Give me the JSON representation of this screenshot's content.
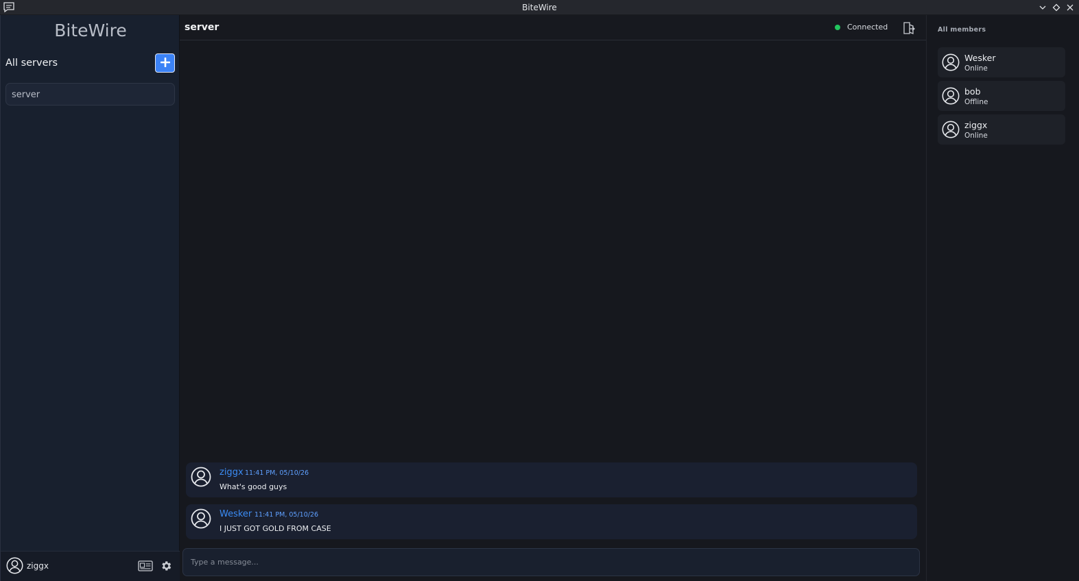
{
  "window": {
    "title": "BiteWire",
    "icons": [
      "chat-bubble-icon",
      "minimize-icon",
      "maximize-icon",
      "close-icon"
    ]
  },
  "sidebar": {
    "brand": "BiteWire",
    "servers_header": "All servers",
    "add_icon": "plus-icon",
    "servers": [
      {
        "name": "server"
      }
    ],
    "user": {
      "name": "ziggx"
    }
  },
  "chat": {
    "channel": "server",
    "status": "Connected",
    "status_color": "#22c55e",
    "messages": [
      {
        "author": "ziggx",
        "time": "11:41 PM, 05/10/26",
        "text": "What's good guys"
      },
      {
        "author": "Wesker",
        "time": "11:41 PM, 05/10/26",
        "text": "I JUST GOT GOLD FROM CASE"
      }
    ],
    "composer": {
      "placeholder": "Type a message...",
      "value": ""
    }
  },
  "members": {
    "header": "All members",
    "list": [
      {
        "name": "Wesker",
        "status": "Online"
      },
      {
        "name": "bob",
        "status": "Offline"
      },
      {
        "name": "ziggx",
        "status": "Online"
      }
    ]
  },
  "colors": {
    "accent": "#3b82f6",
    "author": "#3b8cf5"
  }
}
